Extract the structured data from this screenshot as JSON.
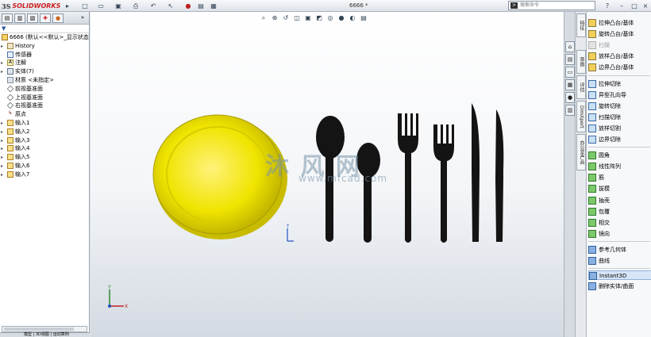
{
  "app": {
    "brand_ds": "3S",
    "brand_name": "SOLIDWORKS",
    "document_title": "6666 *",
    "search_placeholder": "搜索命令"
  },
  "feature_tree": {
    "root": "6666 (默认<<默认>_显示状态",
    "items": [
      {
        "label": "History",
        "icon": "history-icon"
      },
      {
        "label": "传感器",
        "icon": "sensor-icon"
      },
      {
        "label": "注解",
        "icon": "annotation-icon"
      },
      {
        "label": "实体(7)",
        "icon": "solid-bodies-icon"
      },
      {
        "label": "材质 <未指定>",
        "icon": "material-icon"
      },
      {
        "label": "前视基准面",
        "icon": "plane-icon"
      },
      {
        "label": "上视基准面",
        "icon": "plane-icon"
      },
      {
        "label": "右视基准面",
        "icon": "plane-icon"
      },
      {
        "label": "原点",
        "icon": "origin-icon"
      },
      {
        "label": "输入1",
        "icon": "import-icon"
      },
      {
        "label": "输入2",
        "icon": "import-icon"
      },
      {
        "label": "输入3",
        "icon": "import-icon"
      },
      {
        "label": "输入4",
        "icon": "import-icon"
      },
      {
        "label": "输入5",
        "icon": "import-icon"
      },
      {
        "label": "输入6",
        "icon": "import-icon"
      },
      {
        "label": "输入7",
        "icon": "import-icon"
      }
    ],
    "bottom_tabs": "模型 | 3D视图 | 运动算例"
  },
  "right_tabs": {
    "features": "特征",
    "sketch": "草图",
    "evaluate": "评估",
    "dimxpert": "DimXpert",
    "office": "办公室产品"
  },
  "commands": [
    {
      "label": "拉伸凸台/基体",
      "type": "boss"
    },
    {
      "label": "旋转凸台/基体",
      "type": "boss"
    },
    {
      "label": "扫描",
      "type": "disabled"
    },
    {
      "label": "放样凸台/基体",
      "type": "boss"
    },
    {
      "label": "边界凸台/基体",
      "type": "boss"
    },
    {
      "label": "拉伸切除",
      "type": "cut"
    },
    {
      "label": "异型孔向导",
      "type": "cut"
    },
    {
      "label": "旋转切除",
      "type": "cut"
    },
    {
      "label": "扫描切除",
      "type": "cut"
    },
    {
      "label": "放样切割",
      "type": "cut"
    },
    {
      "label": "边界切除",
      "type": "cut"
    },
    {
      "label": "圆角",
      "type": "green"
    },
    {
      "label": "线性阵列",
      "type": "green"
    },
    {
      "label": "筋",
      "type": "green"
    },
    {
      "label": "拔模",
      "type": "green"
    },
    {
      "label": "抽壳",
      "type": "green"
    },
    {
      "label": "包覆",
      "type": "green"
    },
    {
      "label": "相交",
      "type": "green"
    },
    {
      "label": "镜向",
      "type": "green"
    },
    {
      "label": "参考几何体",
      "type": "blue"
    },
    {
      "label": "曲线",
      "type": "blue"
    },
    {
      "label": "Instant3D",
      "type": "blue"
    },
    {
      "label": "删除实体/曲面",
      "type": "blue"
    }
  ],
  "watermark": {
    "cn": "沐 风 网",
    "url": "www.mfcad.com"
  },
  "colors": {
    "plate": "#f0e400",
    "cutlery": "#111111"
  }
}
